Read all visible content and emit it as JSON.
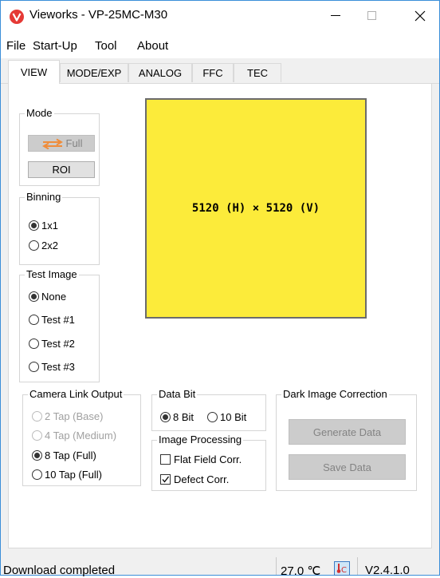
{
  "window": {
    "title": "Vieworks - VP-25MC-M30",
    "minimize_icon": "minimize-icon",
    "maximize_icon": "maximize-icon",
    "close_icon": "close-icon",
    "accent": "#e53935"
  },
  "menu": {
    "file": "File",
    "startup": "Start-Up",
    "tool": "Tool",
    "about": "About"
  },
  "tabs": [
    "VIEW",
    "MODE/EXP",
    "ANALOG",
    "FFC",
    "TEC"
  ],
  "mode": {
    "title": "Mode",
    "full_label": "Full",
    "roi_label": "ROI"
  },
  "binning": {
    "title": "Binning",
    "options": [
      "1x1",
      "2x2"
    ],
    "selected": "1x1"
  },
  "test_image": {
    "title": "Test Image",
    "options": [
      "None",
      "Test #1",
      "Test #2",
      "Test #3"
    ],
    "selected": "None"
  },
  "preview": {
    "resolution_text": "5120 (H) × 5120 (V)",
    "color": "#fceb3a"
  },
  "camera_link": {
    "title": "Camera Link Output",
    "options": [
      "2 Tap (Base)",
      "4 Tap (Medium)",
      "8 Tap (Full)",
      "10 Tap (Full)"
    ],
    "selected": "8 Tap (Full)"
  },
  "data_bit": {
    "title": "Data Bit",
    "options": [
      "8 Bit",
      "10 Bit"
    ],
    "selected": "8 Bit"
  },
  "image_processing": {
    "title": "Image Processing",
    "flat_field": "Flat Field Corr.",
    "flat_field_checked": false,
    "defect": "Defect Corr.",
    "defect_checked": true
  },
  "dark_correction": {
    "title": "Dark Image Correction",
    "generate_label": "Generate Data",
    "save_label": "Save Data"
  },
  "status": {
    "message": "Download completed",
    "temperature": "27.0 ℃",
    "version": "V2.4.1.0",
    "temp_icon": "thermometer-icon"
  }
}
